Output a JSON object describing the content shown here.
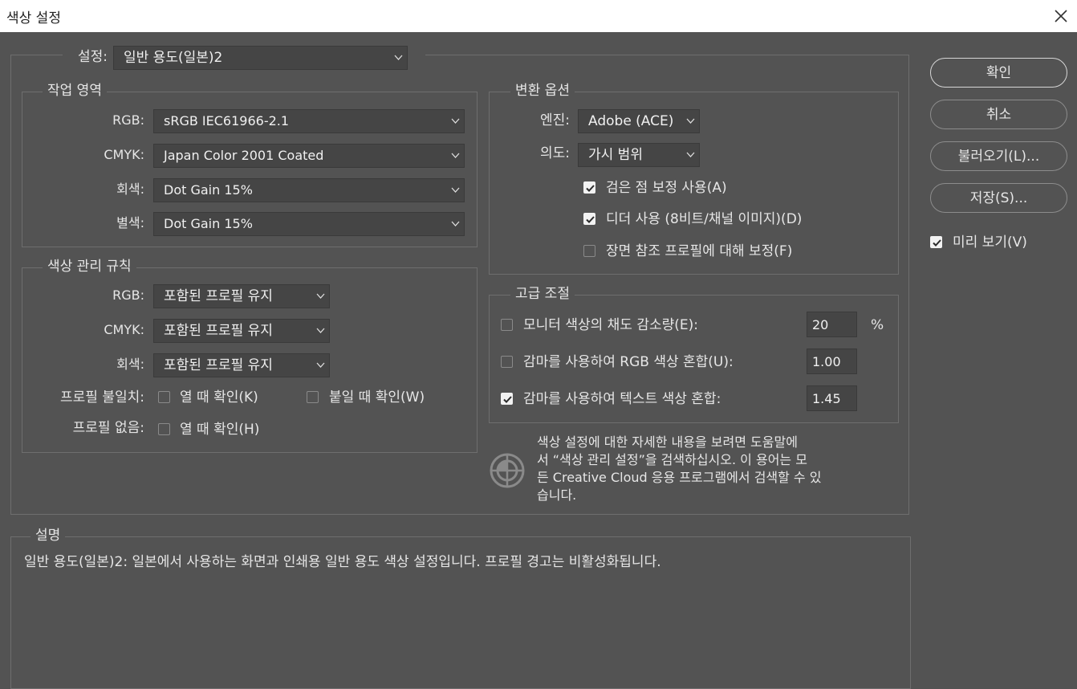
{
  "window": {
    "title": "색상 설정",
    "close_icon": "close-icon"
  },
  "settings": {
    "label": "설정:",
    "value": "일반 용도(일본)2"
  },
  "working_spaces": {
    "legend": "작업 영역",
    "rgb": {
      "label": "RGB:",
      "value": "sRGB IEC61966-2.1"
    },
    "cmyk": {
      "label": "CMYK:",
      "value": "Japan Color 2001 Coated"
    },
    "gray": {
      "label": "회색:",
      "value": "Dot Gain 15%"
    },
    "spot": {
      "label": "별색:",
      "value": "Dot Gain 15%"
    }
  },
  "color_management": {
    "legend": "색상 관리 규칙",
    "rgb": {
      "label": "RGB:",
      "value": "포함된 프로필 유지"
    },
    "cmyk": {
      "label": "CMYK:",
      "value": "포함된 프로필 유지"
    },
    "gray": {
      "label": "회색:",
      "value": "포함된 프로필 유지"
    },
    "mismatch_label": "프로필 불일치:",
    "mismatch_open": {
      "label": "열 때 확인(K)",
      "checked": false
    },
    "mismatch_paste": {
      "label": "붙일 때 확인(W)",
      "checked": false
    },
    "missing_label": "프로필 없음:",
    "missing_open": {
      "label": "열 때 확인(H)",
      "checked": false
    }
  },
  "conversion": {
    "legend": "변환 옵션",
    "engine": {
      "label": "엔진:",
      "value": "Adobe (ACE)"
    },
    "intent": {
      "label": "의도:",
      "value": "가시 범위"
    },
    "black_point": {
      "label": "검은 점 보정 사용(A)",
      "checked": true
    },
    "dither": {
      "label": "디더 사용 (8비트/채널 이미지)(D)",
      "checked": true
    },
    "scene_referred": {
      "label": "장면 참조 프로필에 대해 보정(F)",
      "checked": false
    }
  },
  "advanced": {
    "legend": "고급 조절",
    "desaturate": {
      "label": "모니터 색상의 채도 감소량(E):",
      "value": "20",
      "unit": "%",
      "checked": false
    },
    "blend_rgb": {
      "label": "감마를 사용하여 RGB 색상 혼합(U):",
      "value": "1.00",
      "checked": false
    },
    "blend_text": {
      "label": "감마를 사용하여 텍스트 색상 혼합:",
      "value": "1.45",
      "checked": true
    }
  },
  "help": {
    "line1": "색상 설정에 대한 자세한 내용을 보려면 도움말에",
    "line2": "서 “색상 관리 설정”을 검색하십시오. 이 용어는 모",
    "line3": "든 Creative Cloud 응용 프로그램에서 검색할 수 있",
    "line4": "습니다.",
    "icon": "color-target-icon"
  },
  "description": {
    "legend": "설명",
    "text": "일반 용도(일본)2: 일본에서 사용하는 화면과 인쇄용 일반 용도 색상 설정입니다. 프로필 경고는 비활성화됩니다."
  },
  "buttons": {
    "ok": "확인",
    "cancel": "취소",
    "load": "불러오기(L)...",
    "save": "저장(S)..."
  },
  "preview": {
    "label": "미리 보기(V)",
    "checked": true
  },
  "colors": {
    "background": "#535353",
    "field": "#454545",
    "text": "#e6e6e6",
    "border": "#6e6e6e"
  }
}
